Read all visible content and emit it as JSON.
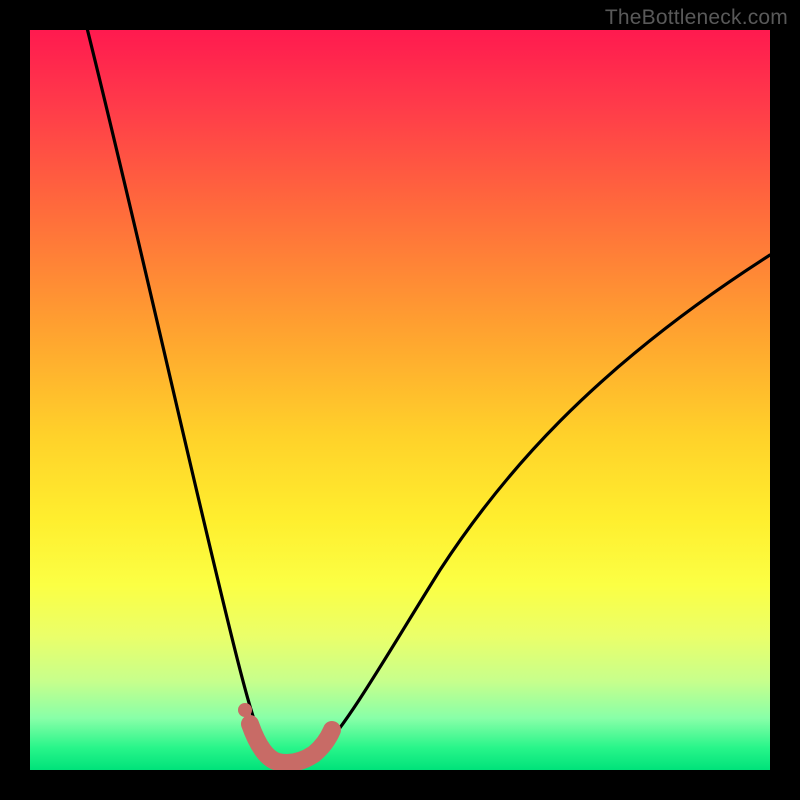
{
  "watermark": {
    "text": "TheBottleneck.com"
  },
  "chart_data": {
    "type": "line",
    "title": "",
    "xlabel": "",
    "ylabel": "",
    "xlim": [
      0,
      100
    ],
    "ylim": [
      0,
      100
    ],
    "series": [
      {
        "name": "bottleneck-curve",
        "x": [
          5,
          10,
          15,
          20,
          25,
          27,
          29,
          31,
          33,
          35,
          37,
          40,
          45,
          50,
          55,
          60,
          65,
          70,
          75,
          80,
          85,
          90,
          95,
          100
        ],
        "values": [
          100,
          80,
          60,
          40,
          18,
          10,
          4,
          1,
          0,
          0,
          1,
          4,
          12,
          21,
          29,
          36,
          42,
          48,
          53,
          57,
          61,
          65,
          68,
          71
        ]
      },
      {
        "name": "highlight-band",
        "x": [
          29,
          30,
          31,
          32,
          33,
          34,
          35,
          36,
          37,
          38
        ],
        "values": [
          3,
          1.5,
          0.6,
          0.2,
          0,
          0,
          0.3,
          0.8,
          1.6,
          2.8
        ]
      },
      {
        "name": "marker-point",
        "x": [
          28.5
        ],
        "values": [
          5
        ]
      }
    ],
    "gradient_stops": [
      {
        "pos": 0,
        "color": "#ff1a4f"
      },
      {
        "pos": 24,
        "color": "#ff6a3c"
      },
      {
        "pos": 55,
        "color": "#ffd22a"
      },
      {
        "pos": 75,
        "color": "#fbff44"
      },
      {
        "pos": 93,
        "color": "#88ffa8"
      },
      {
        "pos": 100,
        "color": "#00e27a"
      }
    ]
  }
}
